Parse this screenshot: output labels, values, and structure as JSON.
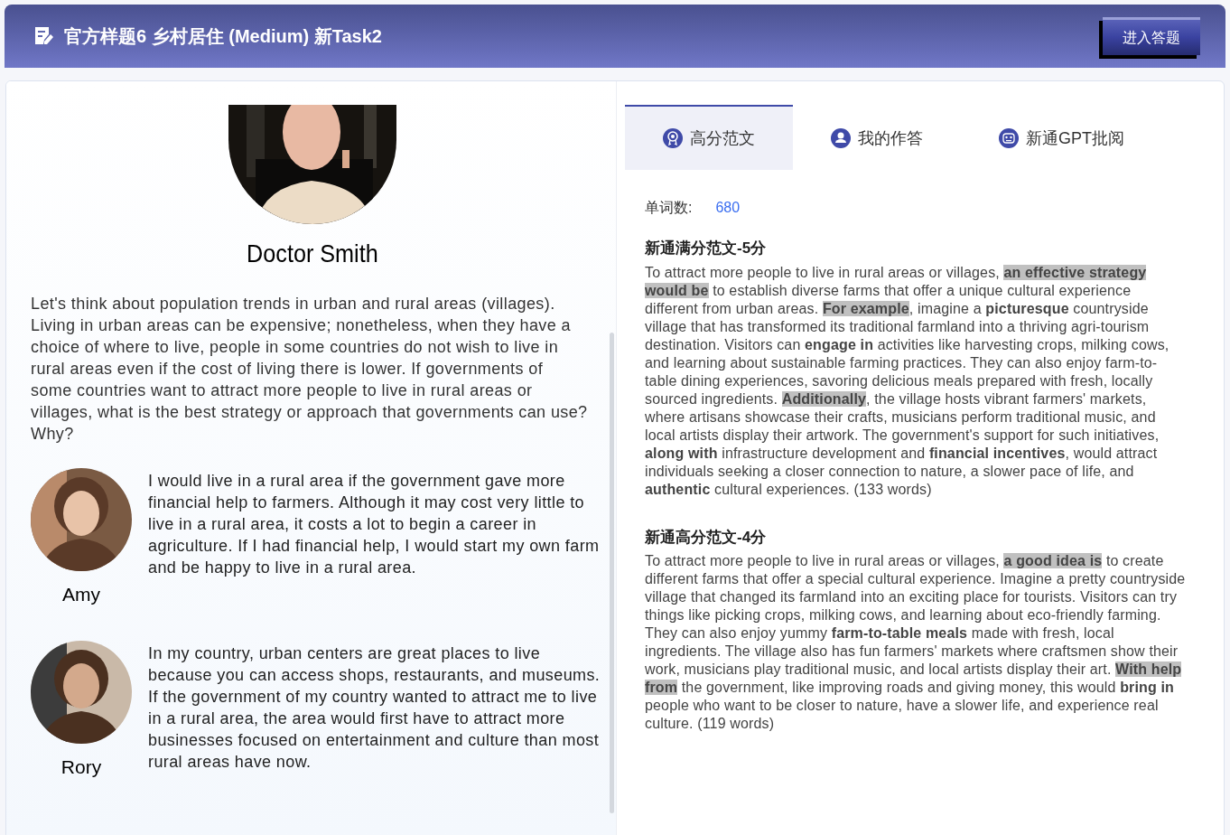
{
  "header": {
    "title": "官方样题6 乡村居住 (Medium) 新Task2",
    "button": "进入答题"
  },
  "prompt": {
    "speaker": "Doctor Smith",
    "text": "Let's think about population trends in urban and rural areas (villages). Living in urban areas can be expensive; nonetheless, when they have a choice of where to live, people in some countries do not wish to live in rural areas even if the cost of living there is lower. If governments of some countries want to attract more people to live in rural areas or villages, what is the best strategy or approach that governments can use? Why?"
  },
  "responses": [
    {
      "name": "Amy",
      "text": "I would live in a rural area if the government gave more financial help to farmers. Although it may cost very little to live in a rural area, it costs a lot to begin a career in agriculture. If I had financial help, I would start my own farm and be happy to live in a rural area."
    },
    {
      "name": "Rory",
      "text": "In my country, urban centers are great places to live because you can access shops, restaurants, and museums. If the government of my country wanted to attract me to live in a rural area, the area would first have to attract more businesses focused on entertainment and culture than most rural areas have now."
    }
  ],
  "tabs": [
    {
      "label": "高分范文",
      "selected": true,
      "kind": "award"
    },
    {
      "label": "我的作答",
      "selected": false,
      "kind": "user"
    },
    {
      "label": "新通GPT批阅",
      "selected": false,
      "kind": "robot"
    }
  ],
  "word_count": {
    "label": "单词数:",
    "value": "680"
  },
  "essays": [
    {
      "title": "新通满分范文-5分",
      "segments": [
        {
          "text": "To attract more people to live in rural areas or villages, ",
          "kind": "plain"
        },
        {
          "text": "an effective strategy would be",
          "kind": "highlight"
        },
        {
          "text": " to establish diverse farms that offer a unique cultural experience different from urban areas. ",
          "kind": "plain"
        },
        {
          "text": "For example",
          "kind": "highlight"
        },
        {
          "text": ", imagine a ",
          "kind": "plain"
        },
        {
          "text": "picturesque",
          "kind": "bold"
        },
        {
          "text": " countryside village that has transformed its traditional farmland into a thriving agri-tourism destination. Visitors can ",
          "kind": "plain"
        },
        {
          "text": "engage in",
          "kind": "bold"
        },
        {
          "text": " activities like harvesting crops, milking cows, and learning about sustainable farming practices. They can also enjoy farm-to-table dining experiences, savoring delicious meals prepared with fresh, locally sourced ingredients. ",
          "kind": "plain"
        },
        {
          "text": "Additionally",
          "kind": "highlight"
        },
        {
          "text": ", the village hosts vibrant farmers' markets, where artisans showcase their crafts, musicians perform traditional music, and local artists display their artwork. The government's support for such initiatives, ",
          "kind": "plain"
        },
        {
          "text": "along with",
          "kind": "bold"
        },
        {
          "text": " infrastructure development and ",
          "kind": "plain"
        },
        {
          "text": "financial incentives",
          "kind": "bold"
        },
        {
          "text": ", would attract individuals seeking a closer connection to nature, a slower pace of life, and ",
          "kind": "plain"
        },
        {
          "text": "authentic",
          "kind": "bold"
        },
        {
          "text": " cultural experiences. (133 words)",
          "kind": "plain"
        }
      ]
    },
    {
      "title": "新通高分范文-4分",
      "segments": [
        {
          "text": "To attract more people to live in rural areas or villages, ",
          "kind": "plain"
        },
        {
          "text": "a good idea is",
          "kind": "highlight"
        },
        {
          "text": " to create different farms that offer a special cultural experience. Imagine a pretty countryside village that changed its farmland into an exciting place for tourists. Visitors can try things like picking crops, milking cows, and learning about eco-friendly farming. They can also enjoy yummy ",
          "kind": "plain"
        },
        {
          "text": "farm-to-table meals",
          "kind": "bold"
        },
        {
          "text": " made with fresh, local ingredients. The village also has fun farmers' markets where craftsmen show their work, musicians play traditional music, and local artists display their art. ",
          "kind": "plain"
        },
        {
          "text": "With help from",
          "kind": "highlight"
        },
        {
          "text": " the government, like improving roads and giving money, this would ",
          "kind": "plain"
        },
        {
          "text": "bring in",
          "kind": "bold"
        },
        {
          "text": " people who want to be closer to nature, have a slower life, and experience real culture. (119 words)",
          "kind": "plain"
        }
      ]
    }
  ]
}
